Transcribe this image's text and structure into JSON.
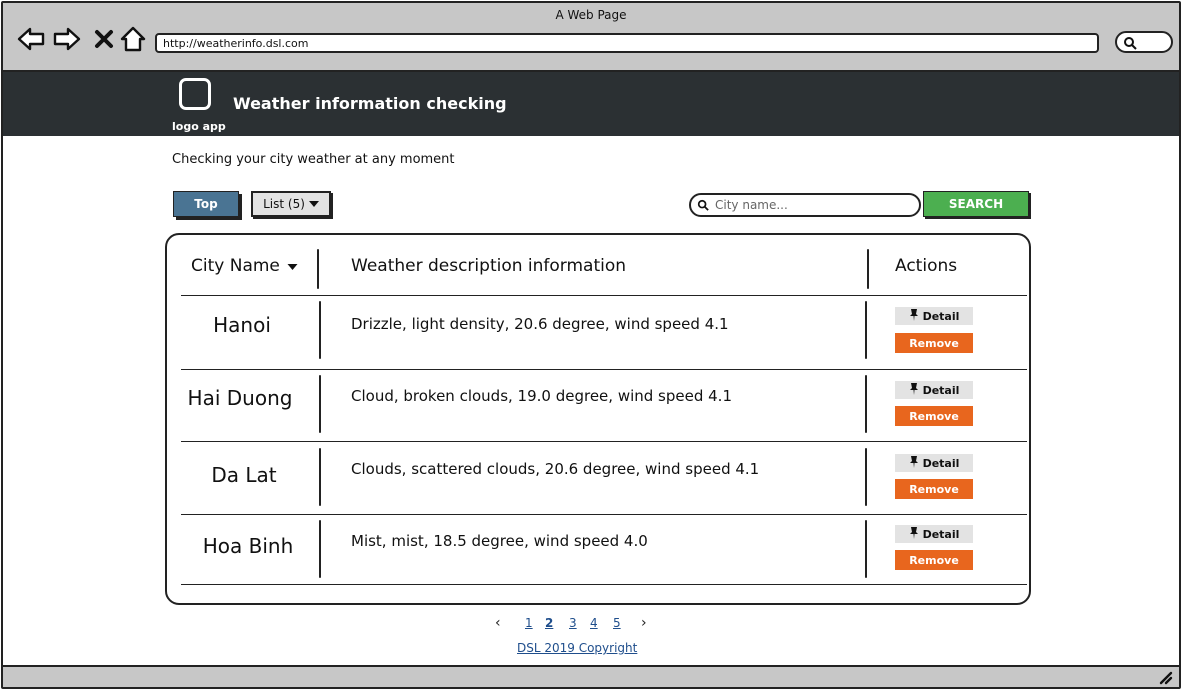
{
  "window": {
    "title": "A Web Page"
  },
  "browser": {
    "url": "http://weatherinfo.dsl.com",
    "icons": [
      "back-icon",
      "forward-icon",
      "close-icon",
      "home-icon",
      "search-icon"
    ]
  },
  "header": {
    "logo_label": "logo app",
    "title": "Weather information checking"
  },
  "tagline": "Checking your city weather at any moment",
  "toolbar": {
    "top_label": "Top",
    "list_label": "List (5)",
    "search_placeholder": "City name...",
    "search_button": "SEARCH"
  },
  "table": {
    "headers": {
      "city": "City Name",
      "desc": "Weather description information",
      "actions": "Actions"
    },
    "detail_label": "Detail",
    "remove_label": "Remove",
    "rows": [
      {
        "city": "Hanoi",
        "desc": "Drizzle, light density, 20.6 degree, wind speed 4.1"
      },
      {
        "city": "Hai Duong",
        "desc": "Cloud, broken clouds, 19.0 degree, wind speed 4.1"
      },
      {
        "city": "Da Lat",
        "desc": "Clouds, scattered clouds, 20.6 degree, wind speed 4.1"
      },
      {
        "city": "Hoa Binh",
        "desc": "Mist, mist, 18.5 degree, wind speed 4.0"
      }
    ]
  },
  "pagination": {
    "prev": "‹",
    "next": "›",
    "pages": [
      "1",
      "2",
      "3",
      "4",
      "5"
    ],
    "current": "2"
  },
  "footer": {
    "copyright": "DSL 2019 Copyright"
  },
  "colors": {
    "header_bg": "#2b3033",
    "top_button": "#4a7493",
    "search_button": "#4caf50",
    "remove_button": "#e8661e",
    "link": "#1f4e8c"
  }
}
